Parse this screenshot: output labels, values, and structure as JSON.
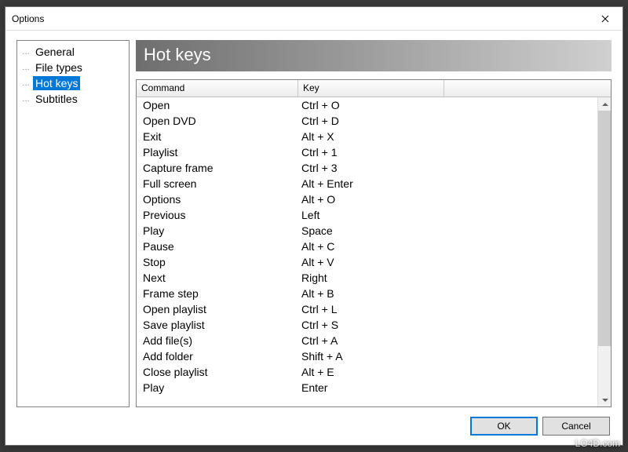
{
  "window": {
    "title": "Options"
  },
  "tree": {
    "items": [
      {
        "label": "General",
        "selected": false
      },
      {
        "label": "File types",
        "selected": false
      },
      {
        "label": "Hot keys",
        "selected": true
      },
      {
        "label": "Subtitles",
        "selected": false
      }
    ]
  },
  "panel": {
    "heading": "Hot keys",
    "columns": {
      "command": "Command",
      "key": "Key"
    },
    "rows": [
      {
        "command": "Open",
        "key": "Ctrl + O"
      },
      {
        "command": "Open DVD",
        "key": "Ctrl + D"
      },
      {
        "command": "Exit",
        "key": "Alt + X"
      },
      {
        "command": "Playlist",
        "key": "Ctrl + 1"
      },
      {
        "command": "Capture frame",
        "key": "Ctrl + 3"
      },
      {
        "command": "Full screen",
        "key": "Alt + Enter"
      },
      {
        "command": "Options",
        "key": "Alt + O"
      },
      {
        "command": "Previous",
        "key": "Left"
      },
      {
        "command": "Play",
        "key": "Space"
      },
      {
        "command": "Pause",
        "key": "Alt + C"
      },
      {
        "command": "Stop",
        "key": "Alt + V"
      },
      {
        "command": "Next",
        "key": "Right"
      },
      {
        "command": "Frame step",
        "key": "Alt + B"
      },
      {
        "command": "Open playlist",
        "key": "Ctrl + L"
      },
      {
        "command": "Save playlist",
        "key": "Ctrl + S"
      },
      {
        "command": "Add file(s)",
        "key": "Ctrl + A"
      },
      {
        "command": "Add folder",
        "key": "Shift + A"
      },
      {
        "command": "Close playlist",
        "key": "Alt + E"
      },
      {
        "command": "Play",
        "key": "Enter"
      }
    ]
  },
  "buttons": {
    "ok": "OK",
    "cancel": "Cancel"
  },
  "watermark": "LO4D.com"
}
